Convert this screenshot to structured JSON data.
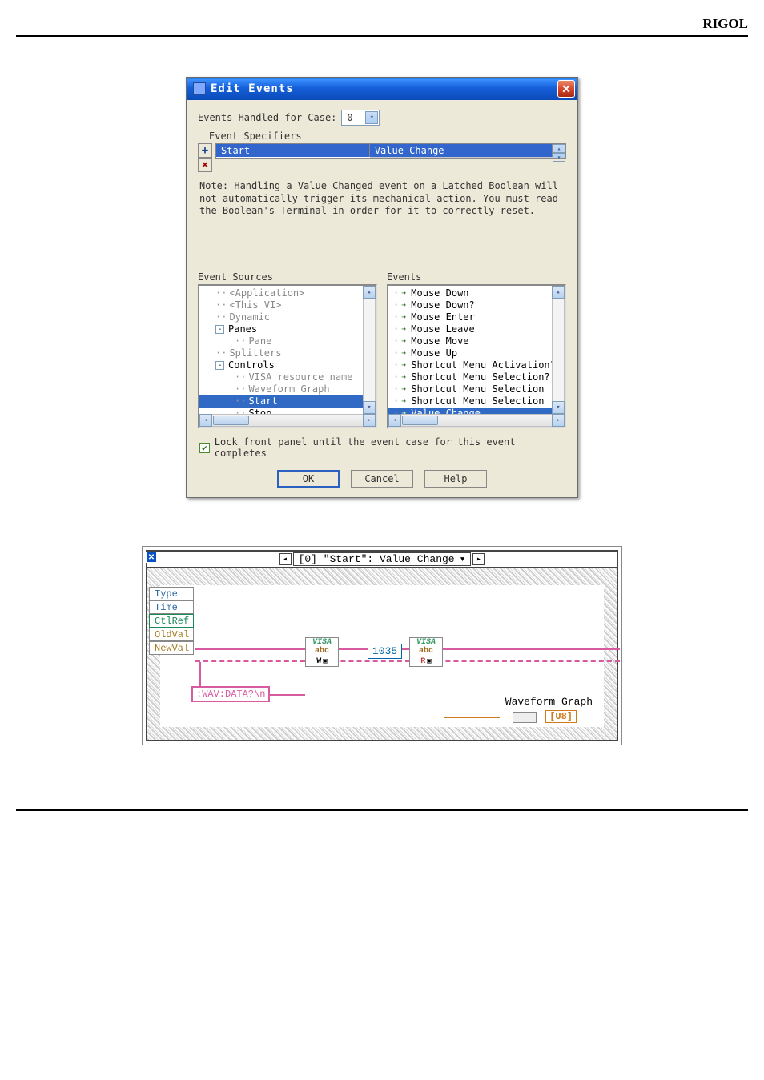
{
  "page": {
    "brand": "RIGOL"
  },
  "dialog": {
    "title": "Edit Events",
    "events_handled_label": "Events Handled for Case:",
    "case_value": "0",
    "specifiers_label": "Event Specifiers",
    "spec_col1": "Start",
    "spec_col2": "Value Change",
    "note": "Note: Handling a Value Changed event on a Latched Boolean will not automatically trigger its mechanical action. You must read the Boolean's Terminal in order for it to correctly reset.",
    "sources_title": "Event Sources",
    "events_title": "Events",
    "sources": [
      {
        "label": "<Application>",
        "indent": 1,
        "grey": true
      },
      {
        "label": "<This VI>",
        "indent": 1,
        "grey": true
      },
      {
        "label": "Dynamic",
        "indent": 1,
        "grey": true
      },
      {
        "label": "Panes",
        "indent": 1,
        "expander": "-"
      },
      {
        "label": "Pane",
        "indent": 2,
        "grey": true
      },
      {
        "label": "Splitters",
        "indent": 1,
        "grey": true
      },
      {
        "label": "Controls",
        "indent": 1,
        "expander": "-"
      },
      {
        "label": "VISA resource name",
        "indent": 2,
        "grey": true
      },
      {
        "label": "Waveform Graph",
        "indent": 2,
        "grey": true
      },
      {
        "label": "Start",
        "indent": 2,
        "selected": true
      },
      {
        "label": "Stop",
        "indent": 2
      }
    ],
    "events": [
      {
        "label": "Mouse Down"
      },
      {
        "label": "Mouse Down?"
      },
      {
        "label": "Mouse Enter"
      },
      {
        "label": "Mouse Leave"
      },
      {
        "label": "Mouse Move"
      },
      {
        "label": "Mouse Up"
      },
      {
        "label": "Shortcut Menu Activation?"
      },
      {
        "label": "Shortcut Menu Selection? (App)"
      },
      {
        "label": "Shortcut Menu Selection (App"
      },
      {
        "label": "Shortcut Menu Selection (User"
      },
      {
        "label": "Value Change",
        "selected": true
      }
    ],
    "lock_label": "Lock front panel until the event case for this event completes",
    "buttons": {
      "ok": "OK",
      "cancel": "Cancel",
      "help": "Help"
    }
  },
  "bd": {
    "case_label": "[0] \"Start\": Value Change",
    "terms": {
      "type": "Type",
      "time": "Time",
      "ctlref": "CtlRef",
      "oldval": "OldVal",
      "newval": "NewVal"
    },
    "visa_write": {
      "l1": "VISA",
      "l2": "abc",
      "l3": "W"
    },
    "visa_read": {
      "l1": "VISA",
      "l2": "abc",
      "l3": "R"
    },
    "byte_count": "1035",
    "cmd": ":WAV:DATA?\\n",
    "wave_label": "Waveform Graph",
    "wave_term": "[U8]"
  }
}
